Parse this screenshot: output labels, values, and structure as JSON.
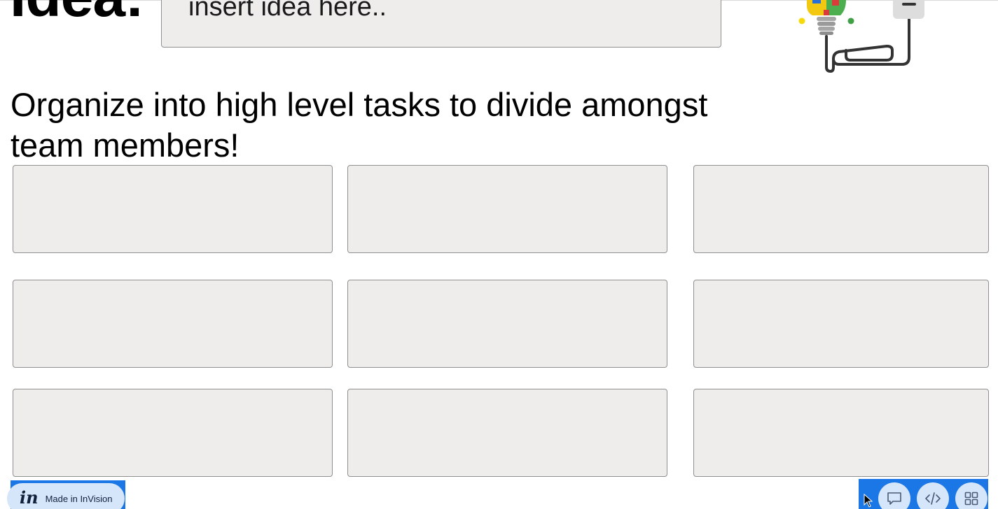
{
  "idea": {
    "heading": "Idea:",
    "input_placeholder": "insert idea here.."
  },
  "instructions": "Organize into high level tasks to divide amongst team members!",
  "task_grid": {
    "rows": 3,
    "columns": 3,
    "tasks": [
      "",
      "",
      "",
      "",
      "",
      "",
      "",
      "",
      ""
    ]
  },
  "footer": {
    "badge_label": "Made in InVision",
    "badge_logo": "in",
    "actions": [
      {
        "name": "comment-icon"
      },
      {
        "name": "code-icon"
      },
      {
        "name": "grid-icon"
      }
    ]
  },
  "colors": {
    "box_fill": "#efecec",
    "box_border": "#8f8f8f",
    "footer_blue": "#1c77e6",
    "button_light_blue": "#d5e6fb"
  }
}
